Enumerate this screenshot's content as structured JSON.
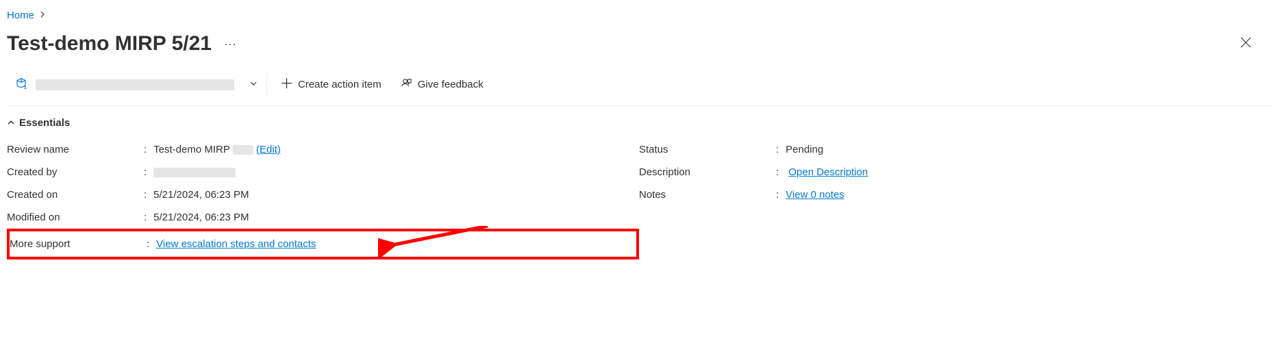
{
  "breadcrumb": {
    "home": "Home"
  },
  "header": {
    "title": "Test-demo MIRP 5/21"
  },
  "toolbar": {
    "create_action": "Create action item",
    "give_feedback": "Give feedback"
  },
  "essentials": {
    "section_label": "Essentials",
    "left": [
      {
        "label": "Review name",
        "value": "Test-demo MIRP",
        "edit": "(Edit)"
      },
      {
        "label": "Created by",
        "value": ""
      },
      {
        "label": "Created on",
        "value": "5/21/2024, 06:23 PM"
      },
      {
        "label": "Modified on",
        "value": "5/21/2024, 06:23 PM"
      },
      {
        "label": "More support",
        "link": "View escalation steps and contacts"
      }
    ],
    "right": [
      {
        "label": "Status",
        "value": "Pending"
      },
      {
        "label": "Description",
        "link": "Open Description"
      },
      {
        "label": "Notes",
        "link": "View 0 notes"
      }
    ]
  }
}
